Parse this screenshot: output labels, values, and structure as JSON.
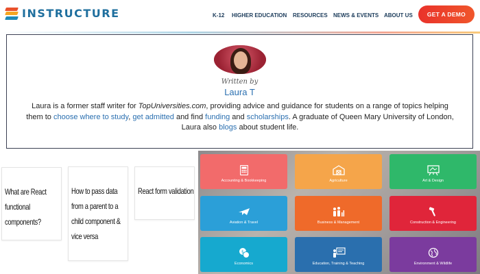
{
  "header": {
    "logo_text": "INSTRUCTURE",
    "nav": [
      {
        "label": "K-12"
      },
      {
        "label": "HIGHER EDUCATION"
      },
      {
        "label": "RESOURCES"
      },
      {
        "label": "NEWS & EVENTS"
      },
      {
        "label": "ABOUT US"
      }
    ],
    "cta_label": "GET A DEMO"
  },
  "author": {
    "written_by": "Written by",
    "name": "Laura T",
    "bio": {
      "t1": "Laura is a former staff writer for ",
      "site": "TopUniversities.com",
      "t2": ", providing advice and guidance for students on a range of topics helping them to ",
      "link1": "choose where to study",
      "t3": ", ",
      "link2": "get admitted",
      "t4": " and find ",
      "link3": "funding",
      "t5": " and ",
      "link4": "scholarships",
      "t6": ". A graduate of Queen Mary University of London, Laura also ",
      "link5": "blogs",
      "t7": " about student life."
    }
  },
  "articles": [
    {
      "title": "What are React functional components?"
    },
    {
      "title": "How to pass data from a parent to a child component & vice versa"
    },
    {
      "title": "React form validation"
    }
  ],
  "subjects": [
    {
      "label": "Accounting & Bookkeeping",
      "icon": "calculator-icon",
      "color": "#f26b6b"
    },
    {
      "label": "Agriculture",
      "icon": "barn-icon",
      "color": "#f5a54a"
    },
    {
      "label": "Art & Design",
      "icon": "easel-icon",
      "color": "#2fb86a"
    },
    {
      "label": "Aviation & Travel",
      "icon": "airplane-icon",
      "color": "#2b9fd8"
    },
    {
      "label": "Business & Management",
      "icon": "people-chart-icon",
      "color": "#ef6a2a"
    },
    {
      "label": "Construction & Engineering",
      "icon": "hammer-icon",
      "color": "#e0253a"
    },
    {
      "label": "Economics",
      "icon": "coins-icon",
      "color": "#16a9cf"
    },
    {
      "label": "Education, Training & Teaching",
      "icon": "teacher-board-icon",
      "color": "#2a6fae"
    },
    {
      "label": "Environment & Wildlife",
      "icon": "globe-icon",
      "color": "#7b3b9e"
    }
  ],
  "colors": {
    "brand_navy": "#1b3b5a",
    "brand_teal": "#1f8ab8",
    "cta_red": "#e9322b",
    "link_blue": "#2a6fb0"
  }
}
